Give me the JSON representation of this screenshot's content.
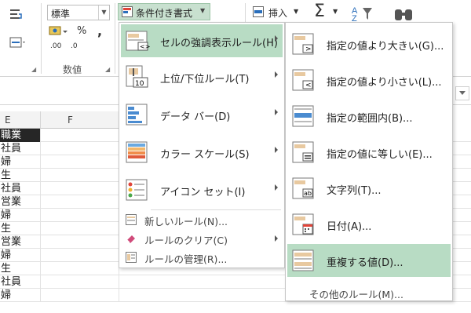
{
  "ribbon": {
    "number_format": "標準",
    "percent": "%",
    "comma": ",",
    "decimal_up": ".00",
    "decimal_down": ".0",
    "number_group": "数値",
    "conditional_formatting": "条件付き書式",
    "insert": "挿入",
    "sum": "Σ"
  },
  "sheet": {
    "col_e": "E",
    "col_f": "F",
    "cells": [
      "職業",
      "社員",
      "婦",
      "生",
      "社員",
      "営業",
      "婦",
      "生",
      "営業",
      "婦",
      "生",
      "社員",
      "婦"
    ]
  },
  "menu1": {
    "items": [
      {
        "label": "セルの強調表示ルール(H)"
      },
      {
        "label": "上位/下位ルール(T)"
      },
      {
        "label": "データ バー(D)"
      },
      {
        "label": "カラー スケール(S)"
      },
      {
        "label": "アイコン セット(I)"
      }
    ],
    "small_items": [
      {
        "label": "新しいルール(N)..."
      },
      {
        "label": "ルールのクリア(C)"
      },
      {
        "label": "ルールの管理(R)..."
      }
    ]
  },
  "menu2": {
    "items": [
      {
        "label": "指定の値より大きい(G)..."
      },
      {
        "label": "指定の値より小さい(L)..."
      },
      {
        "label": "指定の範囲内(B)..."
      },
      {
        "label": "指定の値に等しい(E)..."
      },
      {
        "label": "文字列(T)..."
      },
      {
        "label": "日付(A)..."
      },
      {
        "label": "重複する値(D)..."
      }
    ],
    "more": "その他のルール(M)..."
  },
  "colors": {
    "highlight": "#b8dcc4",
    "header_cell": "#262626"
  }
}
